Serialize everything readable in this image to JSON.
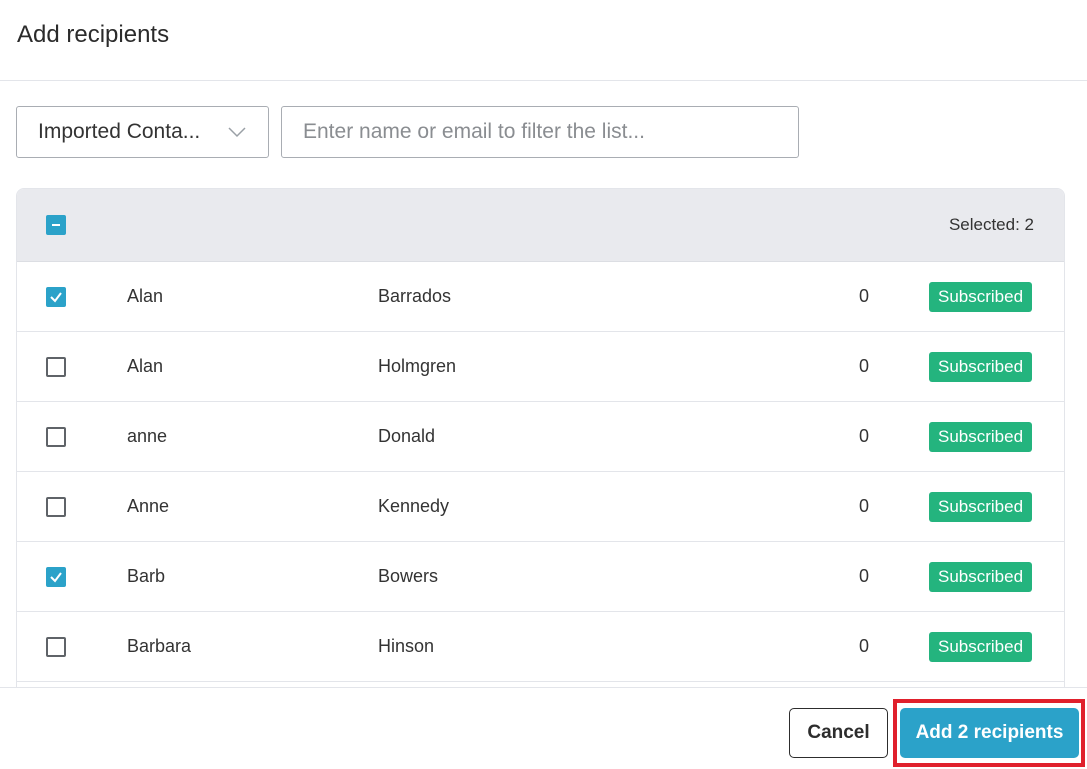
{
  "dialog": {
    "title": "Add recipients"
  },
  "filters": {
    "list_select_value": "Imported Conta...",
    "search_placeholder": "Enter name or email to filter the list..."
  },
  "table": {
    "selected_label": "Selected: 2",
    "rows": [
      {
        "first": "Alan",
        "last": "Barrados",
        "count": "0",
        "status": "Subscribed",
        "checked": true
      },
      {
        "first": "Alan",
        "last": "Holmgren",
        "count": "0",
        "status": "Subscribed",
        "checked": false
      },
      {
        "first": "anne",
        "last": "Donald",
        "count": "0",
        "status": "Subscribed",
        "checked": false
      },
      {
        "first": "Anne",
        "last": "Kennedy",
        "count": "0",
        "status": "Subscribed",
        "checked": false
      },
      {
        "first": "Barb",
        "last": "Bowers",
        "count": "0",
        "status": "Subscribed",
        "checked": true
      },
      {
        "first": "Barbara",
        "last": "Hinson",
        "count": "0",
        "status": "Subscribed",
        "checked": false
      }
    ]
  },
  "footer": {
    "cancel_label": "Cancel",
    "add_label": "Add 2 recipients"
  },
  "colors": {
    "accent": "#2ba2c9",
    "badge": "#24b47e",
    "highlight": "#e0202c"
  },
  "icons": {
    "select_toggle": "chevron-down-icon",
    "header_checkbox": "indeterminate-checkbox-icon",
    "row_checkbox": "checkmark-icon"
  }
}
